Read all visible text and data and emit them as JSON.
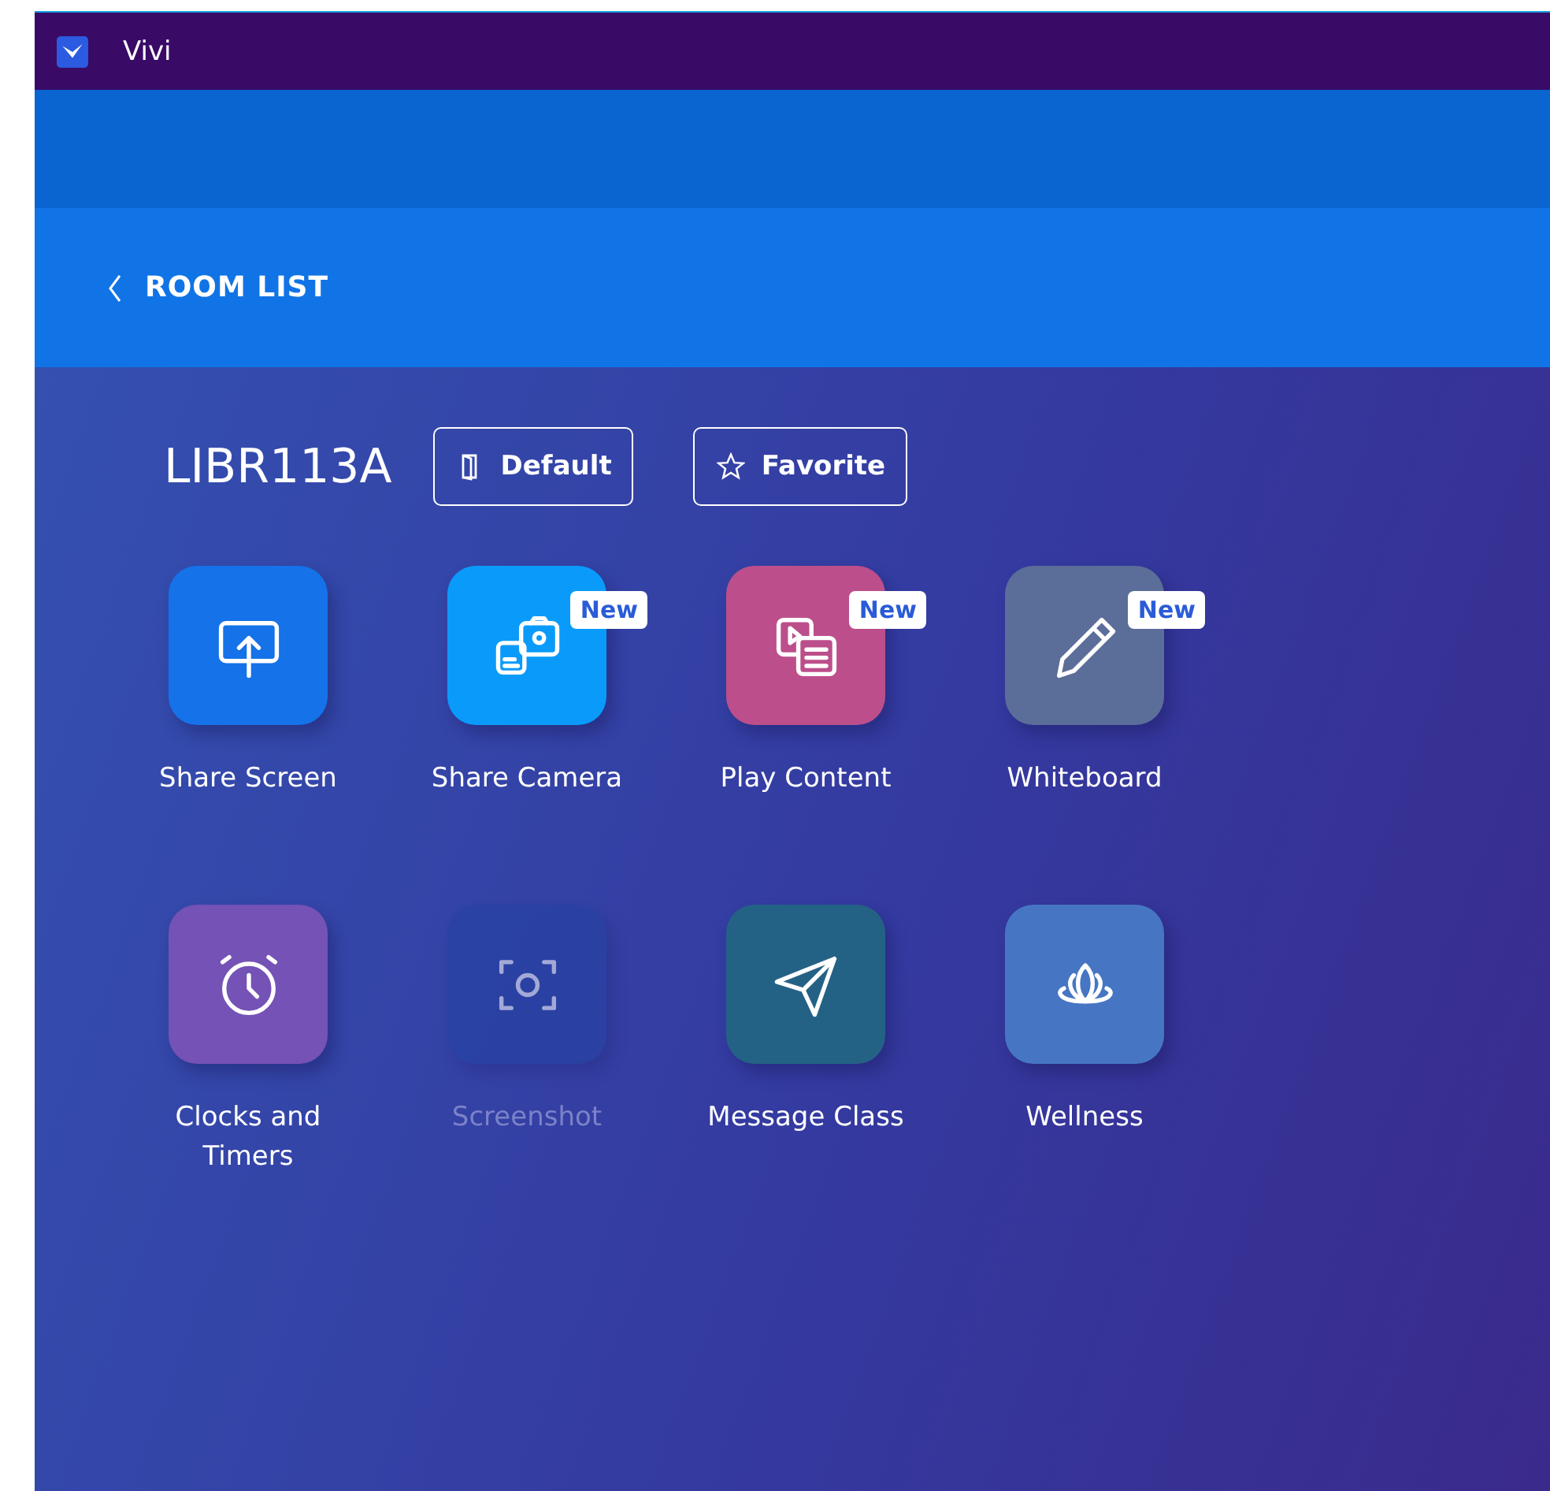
{
  "window": {
    "title": "Vivi"
  },
  "nav": {
    "back_label": "ROOM LIST"
  },
  "room": {
    "name": "LIBR113A",
    "buttons": [
      {
        "kind": "door",
        "label": "Default"
      },
      {
        "kind": "star",
        "label": "Favorite"
      }
    ]
  },
  "tiles": [
    {
      "kind": "share-screen",
      "label": "Share Screen",
      "color": "#1572e8",
      "disabled": false
    },
    {
      "kind": "camera",
      "label": "Share Camera",
      "color": "#0a9bfa",
      "new_badge": "New",
      "disabled": false
    },
    {
      "kind": "content",
      "label": "Play Content",
      "color": "#bc4f8b",
      "new_badge": "New",
      "disabled": false
    },
    {
      "kind": "pencil",
      "label": "Whiteboard",
      "color": "#5b6d99",
      "new_badge": "New",
      "disabled": false
    },
    {
      "kind": "clock",
      "label": "Clocks and Timers",
      "color": "#7552b5",
      "disabled": false
    },
    {
      "kind": "screenshot",
      "label": "Screenshot",
      "color": "#2342a2",
      "disabled": true
    },
    {
      "kind": "send",
      "label": "Message Class",
      "color": "#246285",
      "disabled": false
    },
    {
      "kind": "lotus",
      "label": "Wellness",
      "color": "#4676c3",
      "disabled": false
    }
  ]
}
